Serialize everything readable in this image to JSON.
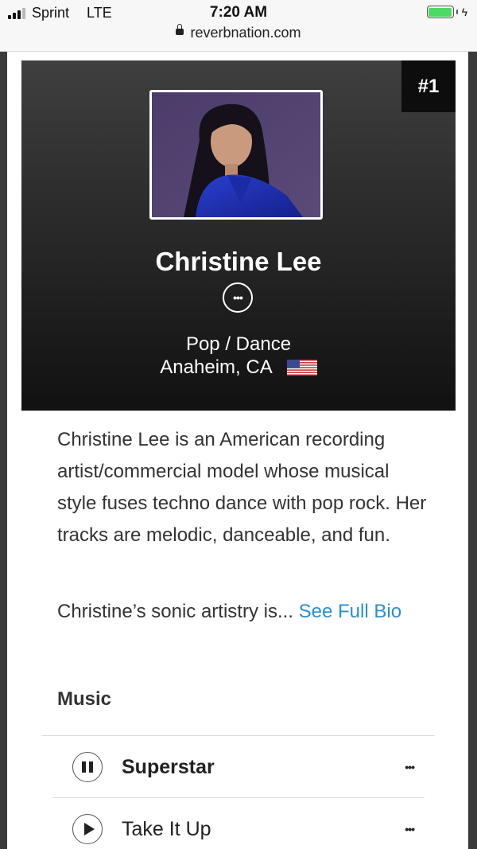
{
  "status_bar": {
    "carrier": "Sprint",
    "network": "LTE",
    "time": "7:20 AM",
    "battery_icon": "battery-charging-icon",
    "battery_color": "#4cd964"
  },
  "browser": {
    "url": "reverbnation.com",
    "lock_icon": "lock-icon"
  },
  "artist": {
    "rank": "#1",
    "name": "Christine Lee",
    "genre": "Pop / Dance",
    "location": "Anaheim, CA",
    "flag_icon": "us-flag-icon"
  },
  "bio": {
    "text": "Christine Lee is an American recording artist/commercial model whose musical style fuses techno dance with pop rock. Her tracks are melodic, danceable, and fun.",
    "teaser": "Christine’s sonic artistry is...",
    "link_label": "See Full Bio",
    "link_color": "#2a8fd1"
  },
  "music": {
    "title": "Music",
    "tracks": [
      {
        "title": "Superstar",
        "state": "playing",
        "control_icon": "pause-icon"
      },
      {
        "title": "Take It Up",
        "state": "stopped",
        "control_icon": "play-icon"
      }
    ]
  }
}
